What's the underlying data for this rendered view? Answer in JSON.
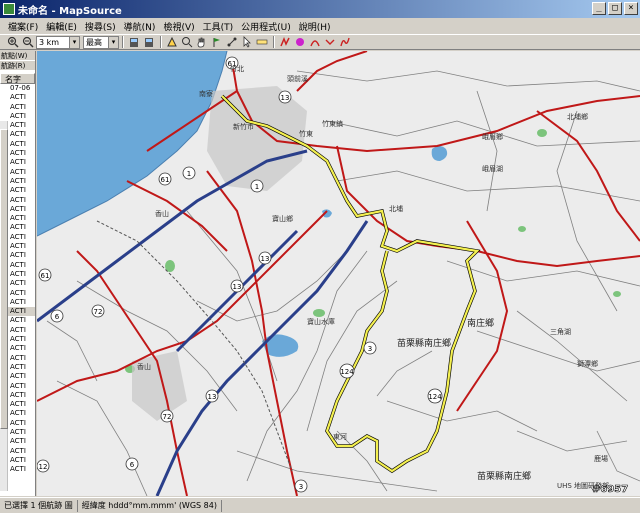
{
  "window": {
    "title": "未命名 - MapSource",
    "ctrl_min": "_",
    "ctrl_max": "□",
    "ctrl_close": "×"
  },
  "menu": [
    "檔案(F)",
    "編輯(E)",
    "搜尋(S)",
    "導航(N)",
    "檢視(V)",
    "工具(T)",
    "公用程式(U)",
    "說明(H)"
  ],
  "toolbar": {
    "scale_value": "3 km",
    "detail_value": "最高"
  },
  "leftpanel": {
    "tab1": "航點(W)",
    "tab2": "航跡(R)",
    "column_header": "名字",
    "rows": [
      "07-06",
      "ACTI",
      "ACTI",
      "ACTI",
      "ACTI",
      "ACTI",
      "ACTI",
      "ACTI",
      "ACTI",
      "ACTI",
      "ACTI",
      "ACTI",
      "ACTI",
      "ACTI",
      "ACTI",
      "ACTI",
      "ACTI",
      "ACTI",
      "ACTI",
      "ACTI",
      "ACTI",
      "ACTI",
      "ACTI",
      "ACTI",
      "ACTI",
      "ACTI",
      "ACTI",
      "ACTI",
      "ACTI",
      "ACTI",
      "ACTI",
      "ACTI",
      "ACTI",
      "ACTI",
      "ACTI",
      "ACTI",
      "ACTI",
      "ACTI",
      "ACTI",
      "ACTI",
      "ACTI",
      "ACTI"
    ]
  },
  "map": {
    "labels": {
      "l1": "香山",
      "l2": "苗栗縣南庄鄉",
      "l3": "苗栗縣南庄鄉",
      "l4": "南庄鄉",
      "l5": "峨眉鄉",
      "l6": "北埔鄉",
      "l7": "竹東鎮",
      "l8": "寶山鄉",
      "l9": "新竹市",
      "l10": "獅潭鄉",
      "l11": "三角湖",
      "l12": "北埔",
      "l13": "峨眉湖",
      "l14": "竹北",
      "l15": "香山",
      "l16": "南寮",
      "l17": "竹東",
      "l18": "頭前溪",
      "l19": "UHS 地圖研發部",
      "l20": "寶山水庫",
      "l21": "鹿場",
      "l22": "東河"
    },
    "shields": {
      "s1": "61",
      "s2": "13",
      "s3": "1",
      "s4": "61",
      "s5": "1",
      "s6": "61",
      "s7": "72",
      "s8": "6",
      "s9": "72",
      "s10": "13",
      "s11": "3",
      "s12": "124",
      "s13": "124",
      "s14": "6",
      "s15": "3",
      "s16": "13",
      "s17": "12",
      "s18": "13"
    },
    "watermark": "#6957"
  },
  "status": {
    "selected": "已選擇 1 個航跡 圖",
    "coord_format": "經緯度 hddd°mm.mmm' (WGS 84)"
  },
  "colors": {
    "highway": "#c01818",
    "expressway": "#2a3f8a",
    "track": "#f4f050",
    "water": "#6aa8d8",
    "park": "#7cc47c",
    "minor_road": "#808080"
  }
}
